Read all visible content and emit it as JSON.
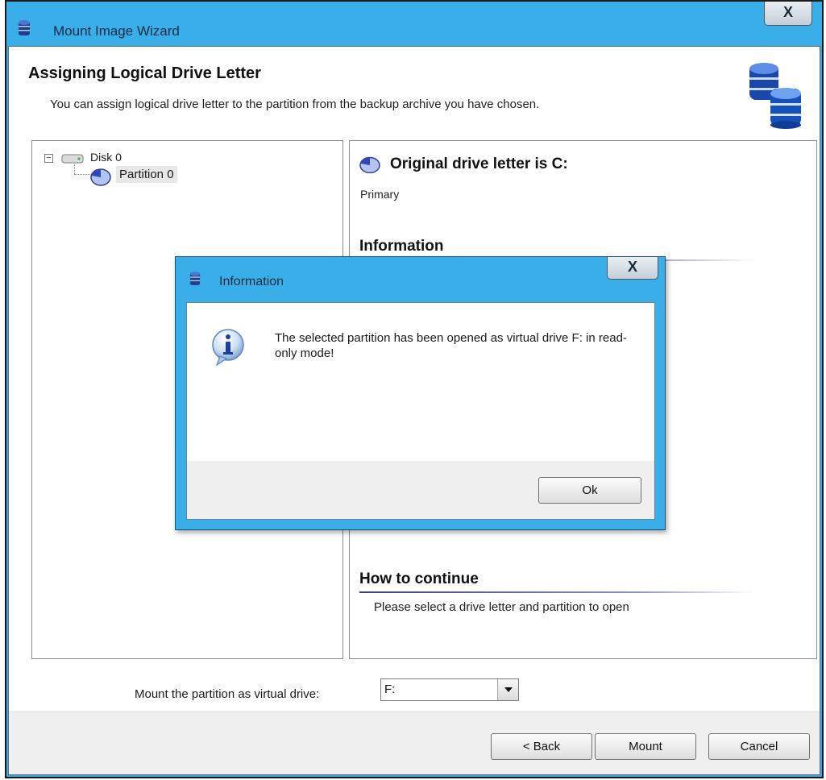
{
  "window": {
    "title": "Mount Image Wizard",
    "close_glyph": "X",
    "icon": "database-icon"
  },
  "header": {
    "title": "Assigning Logical Drive Letter",
    "description": "You can assign logical drive letter to the partition from the backup archive you have chosen.",
    "icon": "databases-icon"
  },
  "tree": {
    "expand_glyph": "−",
    "disk_label": "Disk 0",
    "partition_label": "Partition 0"
  },
  "details": {
    "original_drive": "Original drive letter is C:",
    "partition_type": "Primary",
    "information_heading": "Information",
    "continue_heading": "How to continue",
    "continue_text": "Please select a drive letter and partition to open"
  },
  "mount": {
    "label": "Mount the partition as virtual drive:",
    "selected_drive": "F:"
  },
  "footer": {
    "back_label": "< Back",
    "mount_label": "Mount",
    "cancel_label": "Cancel"
  },
  "dialog": {
    "title": "Information",
    "close_glyph": "X",
    "message": "The selected partition has been opened as virtual drive F: in read-only mode!",
    "ok_label": "Ok",
    "icon": "info-icon"
  },
  "colors": {
    "titlebar": "#3aaee8",
    "footer": "#efefef",
    "rule": "#3b3d86"
  }
}
